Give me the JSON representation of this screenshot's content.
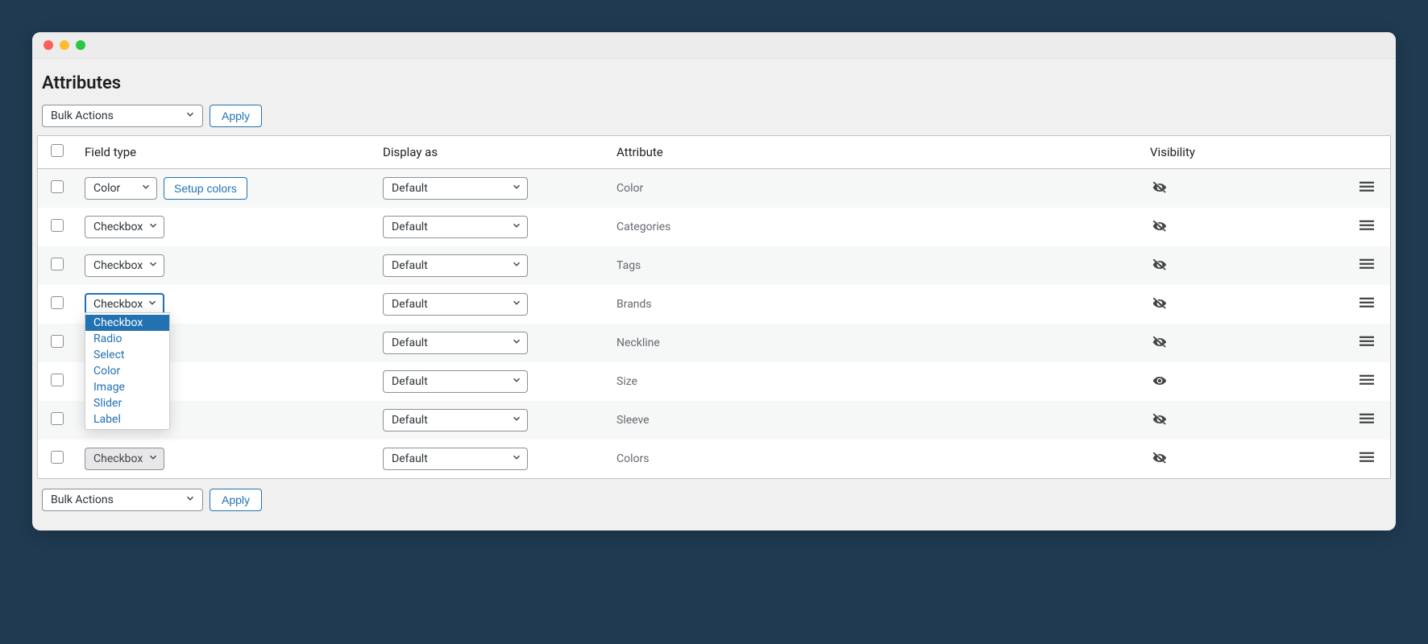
{
  "page_title": "Attributes",
  "bulk": {
    "label": "Bulk Actions",
    "apply_label": "Apply"
  },
  "columns": {
    "field_type": "Field type",
    "display_as": "Display as",
    "attribute": "Attribute",
    "visibility": "Visibility"
  },
  "display_default": "Default",
  "setup_colors_label": "Setup colors",
  "field_type_options": [
    "Checkbox",
    "Radio",
    "Select",
    "Color",
    "Image",
    "Slider",
    "Label"
  ],
  "rows": [
    {
      "field_type": "Color",
      "has_setup": true,
      "display": "Default",
      "attribute": "Color",
      "visible": false,
      "open": false,
      "disabled": false
    },
    {
      "field_type": "Checkbox",
      "has_setup": false,
      "display": "Default",
      "attribute": "Categories",
      "visible": false,
      "open": false,
      "disabled": false
    },
    {
      "field_type": "Checkbox",
      "has_setup": false,
      "display": "Default",
      "attribute": "Tags",
      "visible": false,
      "open": false,
      "disabled": false
    },
    {
      "field_type": "Checkbox",
      "has_setup": false,
      "display": "Default",
      "attribute": "Brands",
      "visible": false,
      "open": true,
      "disabled": false
    },
    {
      "field_type": "",
      "has_setup": false,
      "display": "Default",
      "attribute": "Neckline",
      "visible": false,
      "open": false,
      "disabled": false,
      "hidden_field": true
    },
    {
      "field_type": "",
      "has_setup": false,
      "display": "Default",
      "attribute": "Size",
      "visible": true,
      "open": false,
      "disabled": false,
      "hidden_field": true
    },
    {
      "field_type": "",
      "has_setup": false,
      "display": "Default",
      "attribute": "Sleeve",
      "visible": false,
      "open": false,
      "disabled": false,
      "hidden_field": true
    },
    {
      "field_type": "Checkbox",
      "has_setup": false,
      "display": "Default",
      "attribute": "Colors",
      "visible": false,
      "open": false,
      "disabled": true
    }
  ]
}
